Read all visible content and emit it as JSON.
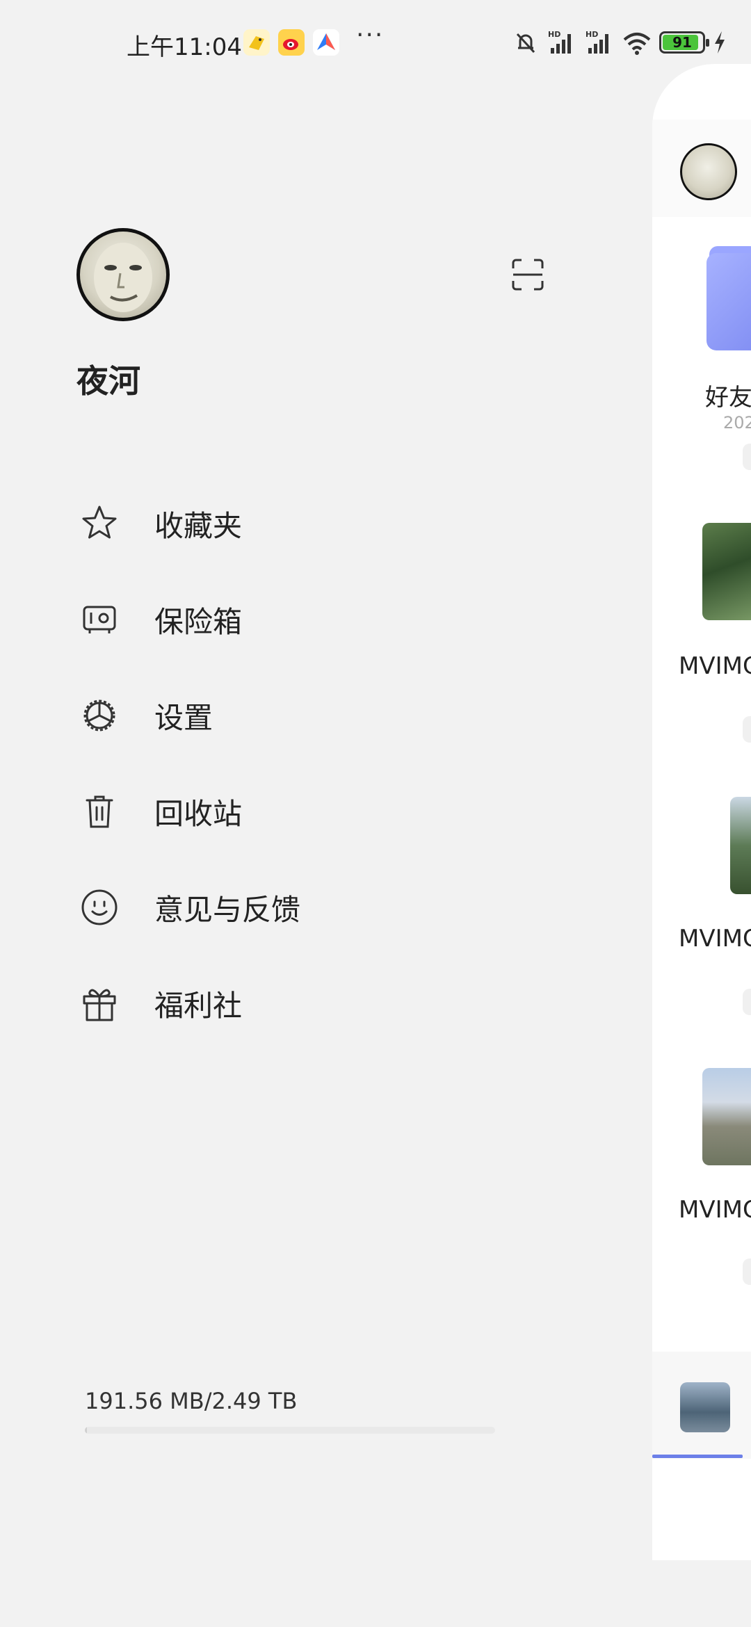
{
  "status_bar": {
    "time": "上午11:04",
    "more": "···",
    "battery": "91",
    "battery_level": 0.91,
    "icons": [
      "bird-app-icon",
      "weibo-icon",
      "maps-app-icon",
      "mute-bell-icon",
      "hd-signal-icon",
      "hd-signal-icon",
      "wifi-icon",
      "battery-icon",
      "charging-icon"
    ]
  },
  "profile": {
    "name": "夜河"
  },
  "menu": [
    {
      "label": "收藏夹",
      "icon": "star-icon"
    },
    {
      "label": "保险箱",
      "icon": "safe-icon"
    },
    {
      "label": "设置",
      "icon": "settings-icon"
    },
    {
      "label": "回收站",
      "icon": "trash-icon"
    },
    {
      "label": "意见与反馈",
      "icon": "smiley-icon"
    },
    {
      "label": "福利社",
      "icon": "gift-icon"
    }
  ],
  "storage": {
    "text": "191.56 MB/2.49 TB",
    "used_fraction": 0.0001
  },
  "right_panel": {
    "folder_name": "好友",
    "folder_date": "202",
    "files": [
      "MVIMC",
      "MVIMC",
      "MVIMC"
    ]
  },
  "colors": {
    "background": "#f2f2f2",
    "accent": "#6c7fe8",
    "battery_green": "#4bc43b"
  }
}
